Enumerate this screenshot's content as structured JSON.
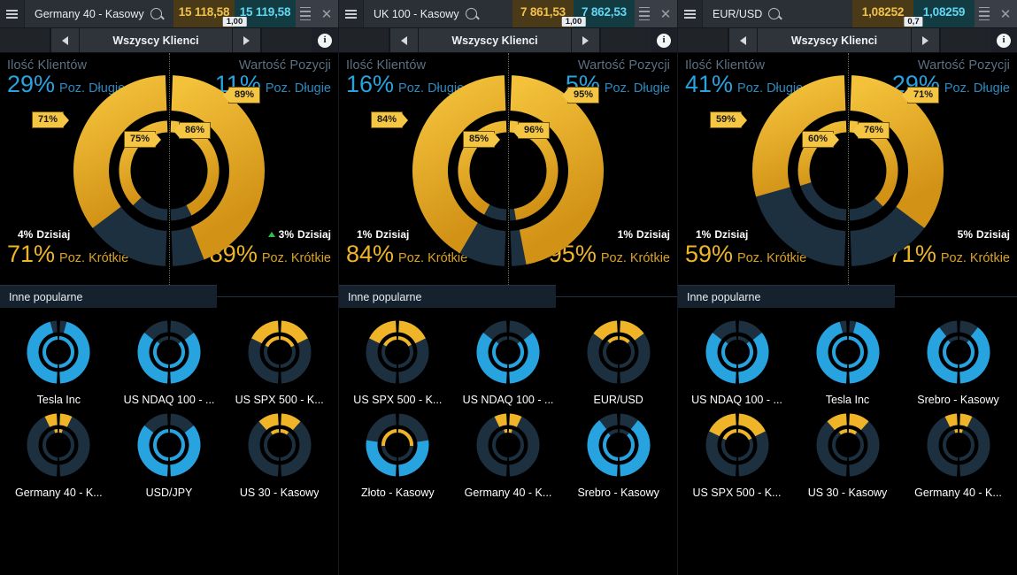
{
  "colors": {
    "long_blue": "#27a3e0",
    "short_gold": "#f0b429",
    "ring_dark": "#1d3040",
    "flag_bg": "#f5c544",
    "bid_bg": "#4a3a18",
    "ask_bg": "#123b42",
    "up_green": "#2fc04a",
    "down_red": "#e03b4a"
  },
  "labels": {
    "nav_title": "Wszyscy Klienci",
    "clients_header": "Ilość Klientów",
    "value_header": "Wartość Pozycji",
    "long_label": "Poz. Długie",
    "short_label": "Poz. Krótkie",
    "today_label": "Dzisiaj",
    "popular_header": "Inne popularne",
    "burger_icon": "hamburger-icon",
    "search_icon": "search-icon",
    "close_icon": "close-icon",
    "info_icon": "info-icon",
    "prev_icon": "chevron-left-icon",
    "next_icon": "chevron-right-icon"
  },
  "panels": [
    {
      "id": "germany40",
      "title": "Germany 40 - Kasowy",
      "bid": "15 118,58",
      "ask": "15 119,58",
      "spread": "1,00",
      "bid_dir": "down",
      "ask_dir": "down",
      "clients": {
        "long_pct": "29%",
        "short_pct": "71%",
        "change": "4%",
        "change_dir": "down",
        "outer_short": 71,
        "inner_short": 75,
        "outer_flag": "71%",
        "inner_flag": "75%"
      },
      "value": {
        "long_pct": "11%",
        "short_pct": "89%",
        "change": "3%",
        "change_dir": "up",
        "outer_short": 89,
        "inner_short": 86,
        "outer_flag": "89%",
        "inner_flag": "86%"
      },
      "popular": [
        {
          "name": "Tesla Inc",
          "outer_long": 93,
          "inner_long": 100,
          "outer_color": "blue",
          "inner_color": "blue"
        },
        {
          "name": "US NDAQ 100 - ...",
          "outer_long": 72,
          "inner_long": 74,
          "outer_color": "blue",
          "inner_color": "blue"
        },
        {
          "name": "US SPX 500 - K...",
          "outer_long": 35,
          "inner_long": 36,
          "outer_color": "gold",
          "inner_color": "gold"
        },
        {
          "name": "Germany 40 - K...",
          "outer_long": 13,
          "inner_long": 7,
          "outer_color": "gold",
          "inner_color": "gold"
        },
        {
          "name": "USD/JPY",
          "outer_long": 72,
          "inner_long": 100,
          "outer_color": "blue",
          "inner_color": "blue"
        },
        {
          "name": "US 30 - Kasowy",
          "outer_long": 22,
          "inner_long": 18,
          "outer_color": "gold",
          "inner_color": "gold"
        }
      ]
    },
    {
      "id": "uk100",
      "title": "UK 100 - Kasowy",
      "bid": "7 861,53",
      "ask": "7 862,53",
      "spread": "1,00",
      "bid_dir": "none",
      "ask_dir": "none",
      "clients": {
        "long_pct": "16%",
        "short_pct": "84%",
        "change": "1%",
        "change_dir": "down",
        "outer_short": 84,
        "inner_short": 85,
        "outer_flag": "84%",
        "inner_flag": "85%"
      },
      "value": {
        "long_pct": "5%",
        "short_pct": "95%",
        "change": "1%",
        "change_dir": "down",
        "outer_short": 95,
        "inner_short": 96,
        "outer_flag": "95%",
        "inner_flag": "96%"
      },
      "popular": [
        {
          "name": "US SPX 500 - K...",
          "outer_long": 35,
          "inner_long": 34,
          "outer_color": "gold",
          "inner_color": "gold"
        },
        {
          "name": "US NDAQ 100 - ...",
          "outer_long": 72,
          "inner_long": 74,
          "outer_color": "blue",
          "inner_color": "blue"
        },
        {
          "name": "EUR/USD",
          "outer_long": 29,
          "inner_long": 24,
          "outer_color": "gold",
          "inner_color": "gold"
        },
        {
          "name": "Złoto - Kasowy",
          "outer_long": 55,
          "inner_long": 52,
          "outer_color": "blue",
          "inner_color": "gold"
        },
        {
          "name": "Germany 40 - K...",
          "outer_long": 13,
          "inner_long": 7,
          "outer_color": "gold",
          "inner_color": "gold"
        },
        {
          "name": "Srebro - Kasowy",
          "outer_long": 80,
          "inner_long": 78,
          "outer_color": "blue",
          "inner_color": "blue"
        }
      ]
    },
    {
      "id": "eurusd",
      "title": "EUR/USD",
      "bid": "1,08252",
      "ask": "1,08259",
      "spread": "0,7",
      "bid_dir": "up",
      "ask_dir": "up",
      "clients": {
        "long_pct": "41%",
        "short_pct": "59%",
        "change": "1%",
        "change_dir": "down",
        "outer_short": 59,
        "inner_short": 60,
        "outer_flag": "59%",
        "inner_flag": "60%"
      },
      "value": {
        "long_pct": "29%",
        "short_pct": "71%",
        "change": "5%",
        "change_dir": "down",
        "outer_short": 71,
        "inner_short": 76,
        "outer_flag": "71%",
        "inner_flag": "76%"
      },
      "popular": [
        {
          "name": "US NDAQ 100 - ...",
          "outer_long": 72,
          "inner_long": 74,
          "outer_color": "blue",
          "inner_color": "blue"
        },
        {
          "name": "Tesla Inc",
          "outer_long": 93,
          "inner_long": 100,
          "outer_color": "blue",
          "inner_color": "blue"
        },
        {
          "name": "Srebro - Kasowy",
          "outer_long": 80,
          "inner_long": 78,
          "outer_color": "blue",
          "inner_color": "blue"
        },
        {
          "name": "US SPX 500 - K...",
          "outer_long": 35,
          "inner_long": 36,
          "outer_color": "gold",
          "inner_color": "gold"
        },
        {
          "name": "US 30 - Kasowy",
          "outer_long": 22,
          "inner_long": 18,
          "outer_color": "gold",
          "inner_color": "gold"
        },
        {
          "name": "Germany 40 - K...",
          "outer_long": 13,
          "inner_long": 7,
          "outer_color": "gold",
          "inner_color": "gold"
        }
      ]
    }
  ]
}
